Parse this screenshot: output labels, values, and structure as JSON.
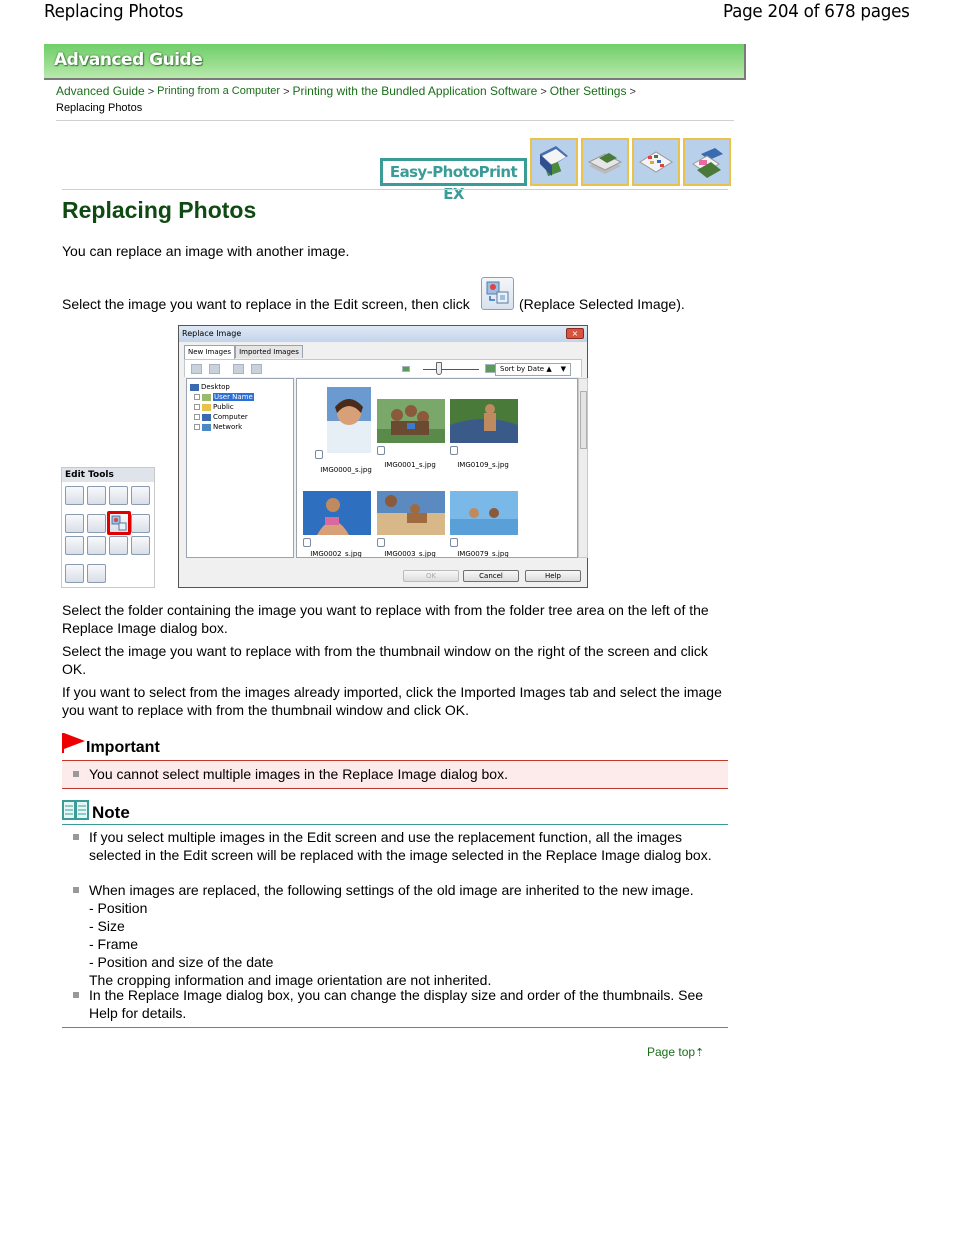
{
  "header": {
    "title": "Replacing Photos",
    "page_info": "Page 204 of 678 pages"
  },
  "banner": {
    "label": "Advanced Guide"
  },
  "breadcrumb": {
    "links": [
      "Advanced Guide",
      "Printing from a Computer",
      "Printing with the Bundled Application Software",
      "Other Settings"
    ],
    "separator": ">",
    "current": "Replacing Photos"
  },
  "app_logo": "Easy-PhotoPrint EX",
  "mode_icons": [
    "album-icon",
    "calendar-icon",
    "layout-print-icon",
    "stickers-icon"
  ],
  "title": "Replacing Photos",
  "intro": "You can replace an image with another image.",
  "step1": {
    "before": "Select the image you want to replace in the Edit screen, then click",
    "after": "(Replace Selected Image)."
  },
  "edit_tools": {
    "title": "Edit Tools"
  },
  "dialog": {
    "title": "Replace Image",
    "close": "×",
    "tabs": [
      "New Images",
      "Imported Images"
    ],
    "sort": "Sort by Date ▲",
    "tree": [
      {
        "label": "Desktop",
        "selected": false
      },
      {
        "label": "User Name",
        "selected": true
      },
      {
        "label": "Public",
        "selected": false
      },
      {
        "label": "Computer",
        "selected": false
      },
      {
        "label": "Network",
        "selected": false
      }
    ],
    "thumbnails": [
      {
        "name": "IMG0000_s.jpg",
        "count": "1"
      },
      {
        "name": "IMG0001_s.jpg",
        "count": "1"
      },
      {
        "name": "IMG0109_s.jpg",
        "count": "1"
      },
      {
        "name": "IMG0002_s.jpg",
        "count": "1"
      },
      {
        "name": "IMG0003_s.jpg",
        "count": "1"
      },
      {
        "name": "IMG0079_s.jpg",
        "count": "1"
      }
    ],
    "buttons": {
      "ok": "OK",
      "cancel": "Cancel",
      "help": "Help"
    }
  },
  "paragraphs": [
    "Select the folder containing the image you want to replace with from the folder tree area on the left of the Replace Image dialog box.",
    "Select the image you want to replace with from the thumbnail window on the right of the screen and click OK.",
    "If you want to select from the images already imported, click the Imported Images tab and select the image you want to replace with from the thumbnail window and click OK."
  ],
  "important": {
    "heading": "Important",
    "items": [
      "You cannot select multiple images in the Replace Image dialog box."
    ]
  },
  "note": {
    "heading": "Note",
    "item1": "If you select multiple images in the Edit screen and use the replacement function, all the images selected in the Edit screen will be replaced with the image selected in the Replace Image dialog box.",
    "item2_intro": "When images are replaced, the following settings of the old image are inherited to the new image.",
    "item2_list": [
      "- Position",
      "- Size",
      "- Frame",
      "- Position and size of the date"
    ],
    "item2_outro": "The cropping information and image orientation are not inherited.",
    "item3": "In the Replace Image dialog box, you can change the display size and order of the thumbnails. See Help for details."
  },
  "page_top": "Page top"
}
